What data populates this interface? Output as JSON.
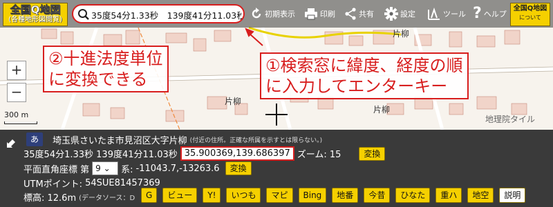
{
  "header": {
    "logo_title": "全国Q地図",
    "logo_sub": "(各種地形図閲覧)",
    "search_value": "35度54分1.33秒　139度41分11.03秒",
    "toolbar": [
      {
        "label": "初期表示",
        "icon": "refresh-icon"
      },
      {
        "label": "印刷",
        "icon": "printer-icon"
      },
      {
        "label": "共有",
        "icon": "share-icon"
      },
      {
        "label": "設定",
        "icon": "gear-icon"
      },
      {
        "label": "ツール",
        "icon": "tools-icon"
      },
      {
        "label": "ヘルプ",
        "icon": "help-icon"
      }
    ],
    "mini_logo_title": "全国Q地図",
    "mini_logo_sub": "について"
  },
  "map": {
    "labels": [
      "片柳",
      "片柳",
      "片柳",
      "地理院タイル"
    ],
    "scale": "300 m",
    "zoom_in": "+",
    "zoom_out": "−"
  },
  "annotations": {
    "left": [
      "②十進法度単位",
      "に変換できる"
    ],
    "right": [
      "①検索窓に緯度、経度の順",
      "に入力してエンターキー"
    ]
  },
  "info": {
    "address_badge": "あ",
    "address": "埼玉県さいたま市見沼区大字片柳",
    "address_note": "(付近の住所。正確な所属を示すとは限らない。)",
    "dms": "35度54分1.33秒 139度41分11.03秒",
    "decimal": "35.900369,139.686397",
    "zoom_label": "ズーム: 15",
    "convert_label": "変換",
    "plane_label": "平面直角座標 第",
    "plane_zone": "9",
    "plane_kei": "系:",
    "plane_coords": "-11043.7,-13263.6",
    "utm_label": "UTMポイント:",
    "utm_value": "54SUE81457369",
    "elev_label": "標高: 12.6m",
    "elev_note": "(データソース：D",
    "links": [
      "G",
      "ビュー",
      "Y!",
      "いつも",
      "マピ",
      "Bing",
      "地番",
      "今昔",
      "ひなた",
      "重ハ",
      "地空",
      "説明"
    ]
  },
  "colors": {
    "accent_yellow": "#f5d000",
    "annotation_red": "#d81e1e",
    "panel_bg": "#3a3a3a"
  }
}
